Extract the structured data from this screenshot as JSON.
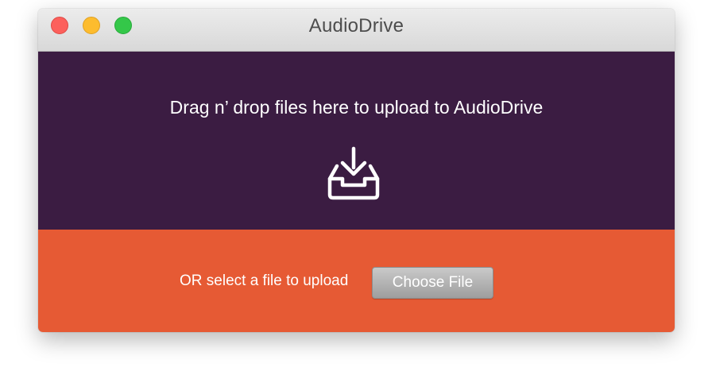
{
  "window": {
    "title": "AudioDrive"
  },
  "drop_zone": {
    "text": "Drag n’ drop files here to upload to AudioDrive",
    "icon": "download-tray-icon",
    "background": "#3b1c42"
  },
  "select_zone": {
    "text": "OR select a file to upload",
    "button_label": "Choose File",
    "background": "#e65a34"
  },
  "traffic_lights": {
    "close": "#fc605c",
    "minimize": "#fdbc2e",
    "maximize": "#34c749"
  }
}
